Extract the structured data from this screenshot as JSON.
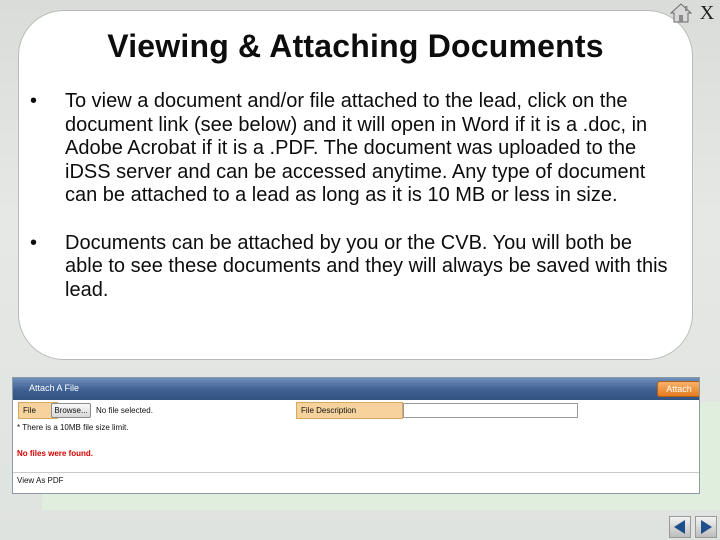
{
  "slide": {
    "title": "Viewing & Attaching Documents",
    "bullet_char": "•",
    "bullets": [
      "To view a document and/or file attached to the lead, click on the document link (see below) and it will open in Word if it is a .doc, in Adobe Acrobat if it is a .PDF. The document was uploaded to the iDSS server and can be accessed anytime.  Any type of document can be attached to a lead as long as it is 10 MB or less in size.",
      "Documents can be attached by you or the CVB.  You will both be able to see these documents and they will always be saved with this lead."
    ]
  },
  "controls": {
    "home_icon": "home-icon",
    "close_label": "X",
    "prev_icon": "arrow-left-icon",
    "next_icon": "arrow-right-icon"
  },
  "screenshot": {
    "header_title": "Attach A File",
    "attach_label": "Attach",
    "file_label": "File",
    "browse_label": "Browse...",
    "no_file_text": "No file selected.",
    "description_label": "File Description",
    "description_value": "",
    "size_note": "* There is a 10MB file size limit.",
    "no_files_found": "No files were found.",
    "view_as_pdf": "View As PDF"
  },
  "colors": {
    "header_blue": "#3d5f92",
    "attach_orange": "#e57c1f",
    "label_tan": "#f6d39c",
    "error_red": "#d60000",
    "green_panel": "#dfeedd"
  }
}
